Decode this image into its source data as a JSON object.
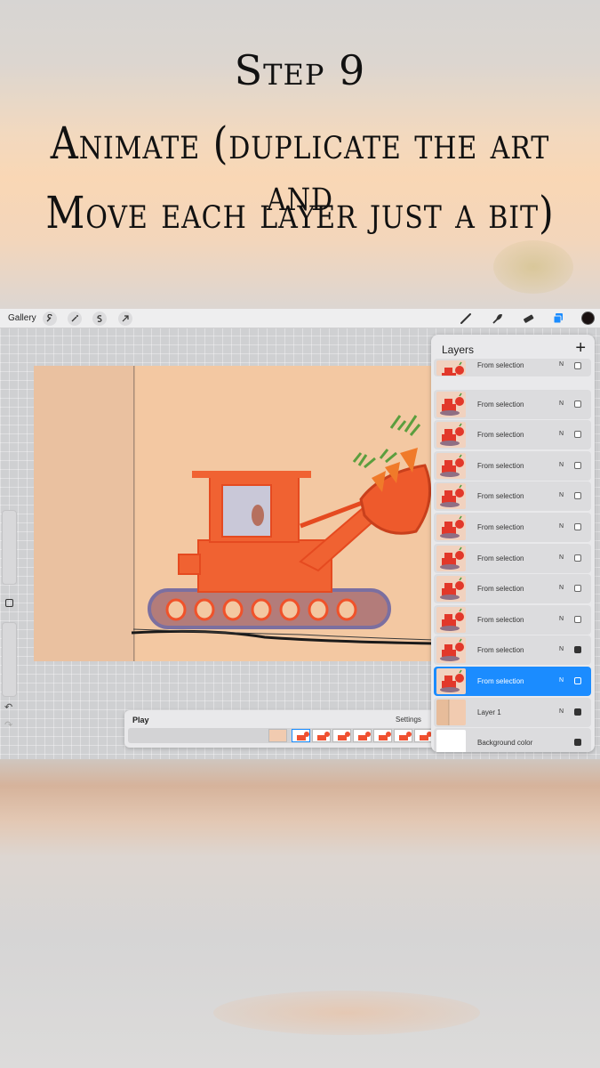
{
  "banner": {
    "line1": "Step 9",
    "line2": "Animate (duplicate the art and",
    "line3": "Move each layer just a bit)"
  },
  "toolbar": {
    "gallery_label": "Gallery",
    "left_icons": [
      "wrench-icon",
      "magic-wand-icon",
      "selection-s-icon",
      "transform-arrow-icon"
    ],
    "right_icons": [
      "brush-icon",
      "smudge-icon",
      "eraser-icon",
      "layers-icon"
    ],
    "active_tool_color": "#1b8cff",
    "current_color": "#1a1111"
  },
  "layers_panel": {
    "title": "Layers",
    "add_label": "+",
    "rows": [
      {
        "name": "From selection",
        "mode": "N",
        "visible": false,
        "active": false
      },
      {
        "name": "From selection",
        "mode": "N",
        "visible": false,
        "active": false
      },
      {
        "name": "From selection",
        "mode": "N",
        "visible": false,
        "active": false
      },
      {
        "name": "From selection",
        "mode": "N",
        "visible": false,
        "active": false
      },
      {
        "name": "From selection",
        "mode": "N",
        "visible": false,
        "active": false
      },
      {
        "name": "From selection",
        "mode": "N",
        "visible": false,
        "active": false
      },
      {
        "name": "From selection",
        "mode": "N",
        "visible": false,
        "active": false
      },
      {
        "name": "From selection",
        "mode": "N",
        "visible": false,
        "active": false
      },
      {
        "name": "From selection",
        "mode": "N",
        "visible": false,
        "active": false
      },
      {
        "name": "From selection",
        "mode": "N",
        "visible": true,
        "active": false
      },
      {
        "name": "From selection",
        "mode": "N",
        "visible": false,
        "active": true
      },
      {
        "name": "Layer 1",
        "mode": "N",
        "visible": true,
        "active": false
      },
      {
        "name": "Background color",
        "mode": "",
        "visible": true,
        "active": false
      }
    ]
  },
  "timeline": {
    "play_label": "Play",
    "settings_label": "Settings"
  },
  "colors": {
    "accent": "#1b8cff",
    "paper": "#f3c8a2",
    "drawing_orange": "#f0522a"
  }
}
